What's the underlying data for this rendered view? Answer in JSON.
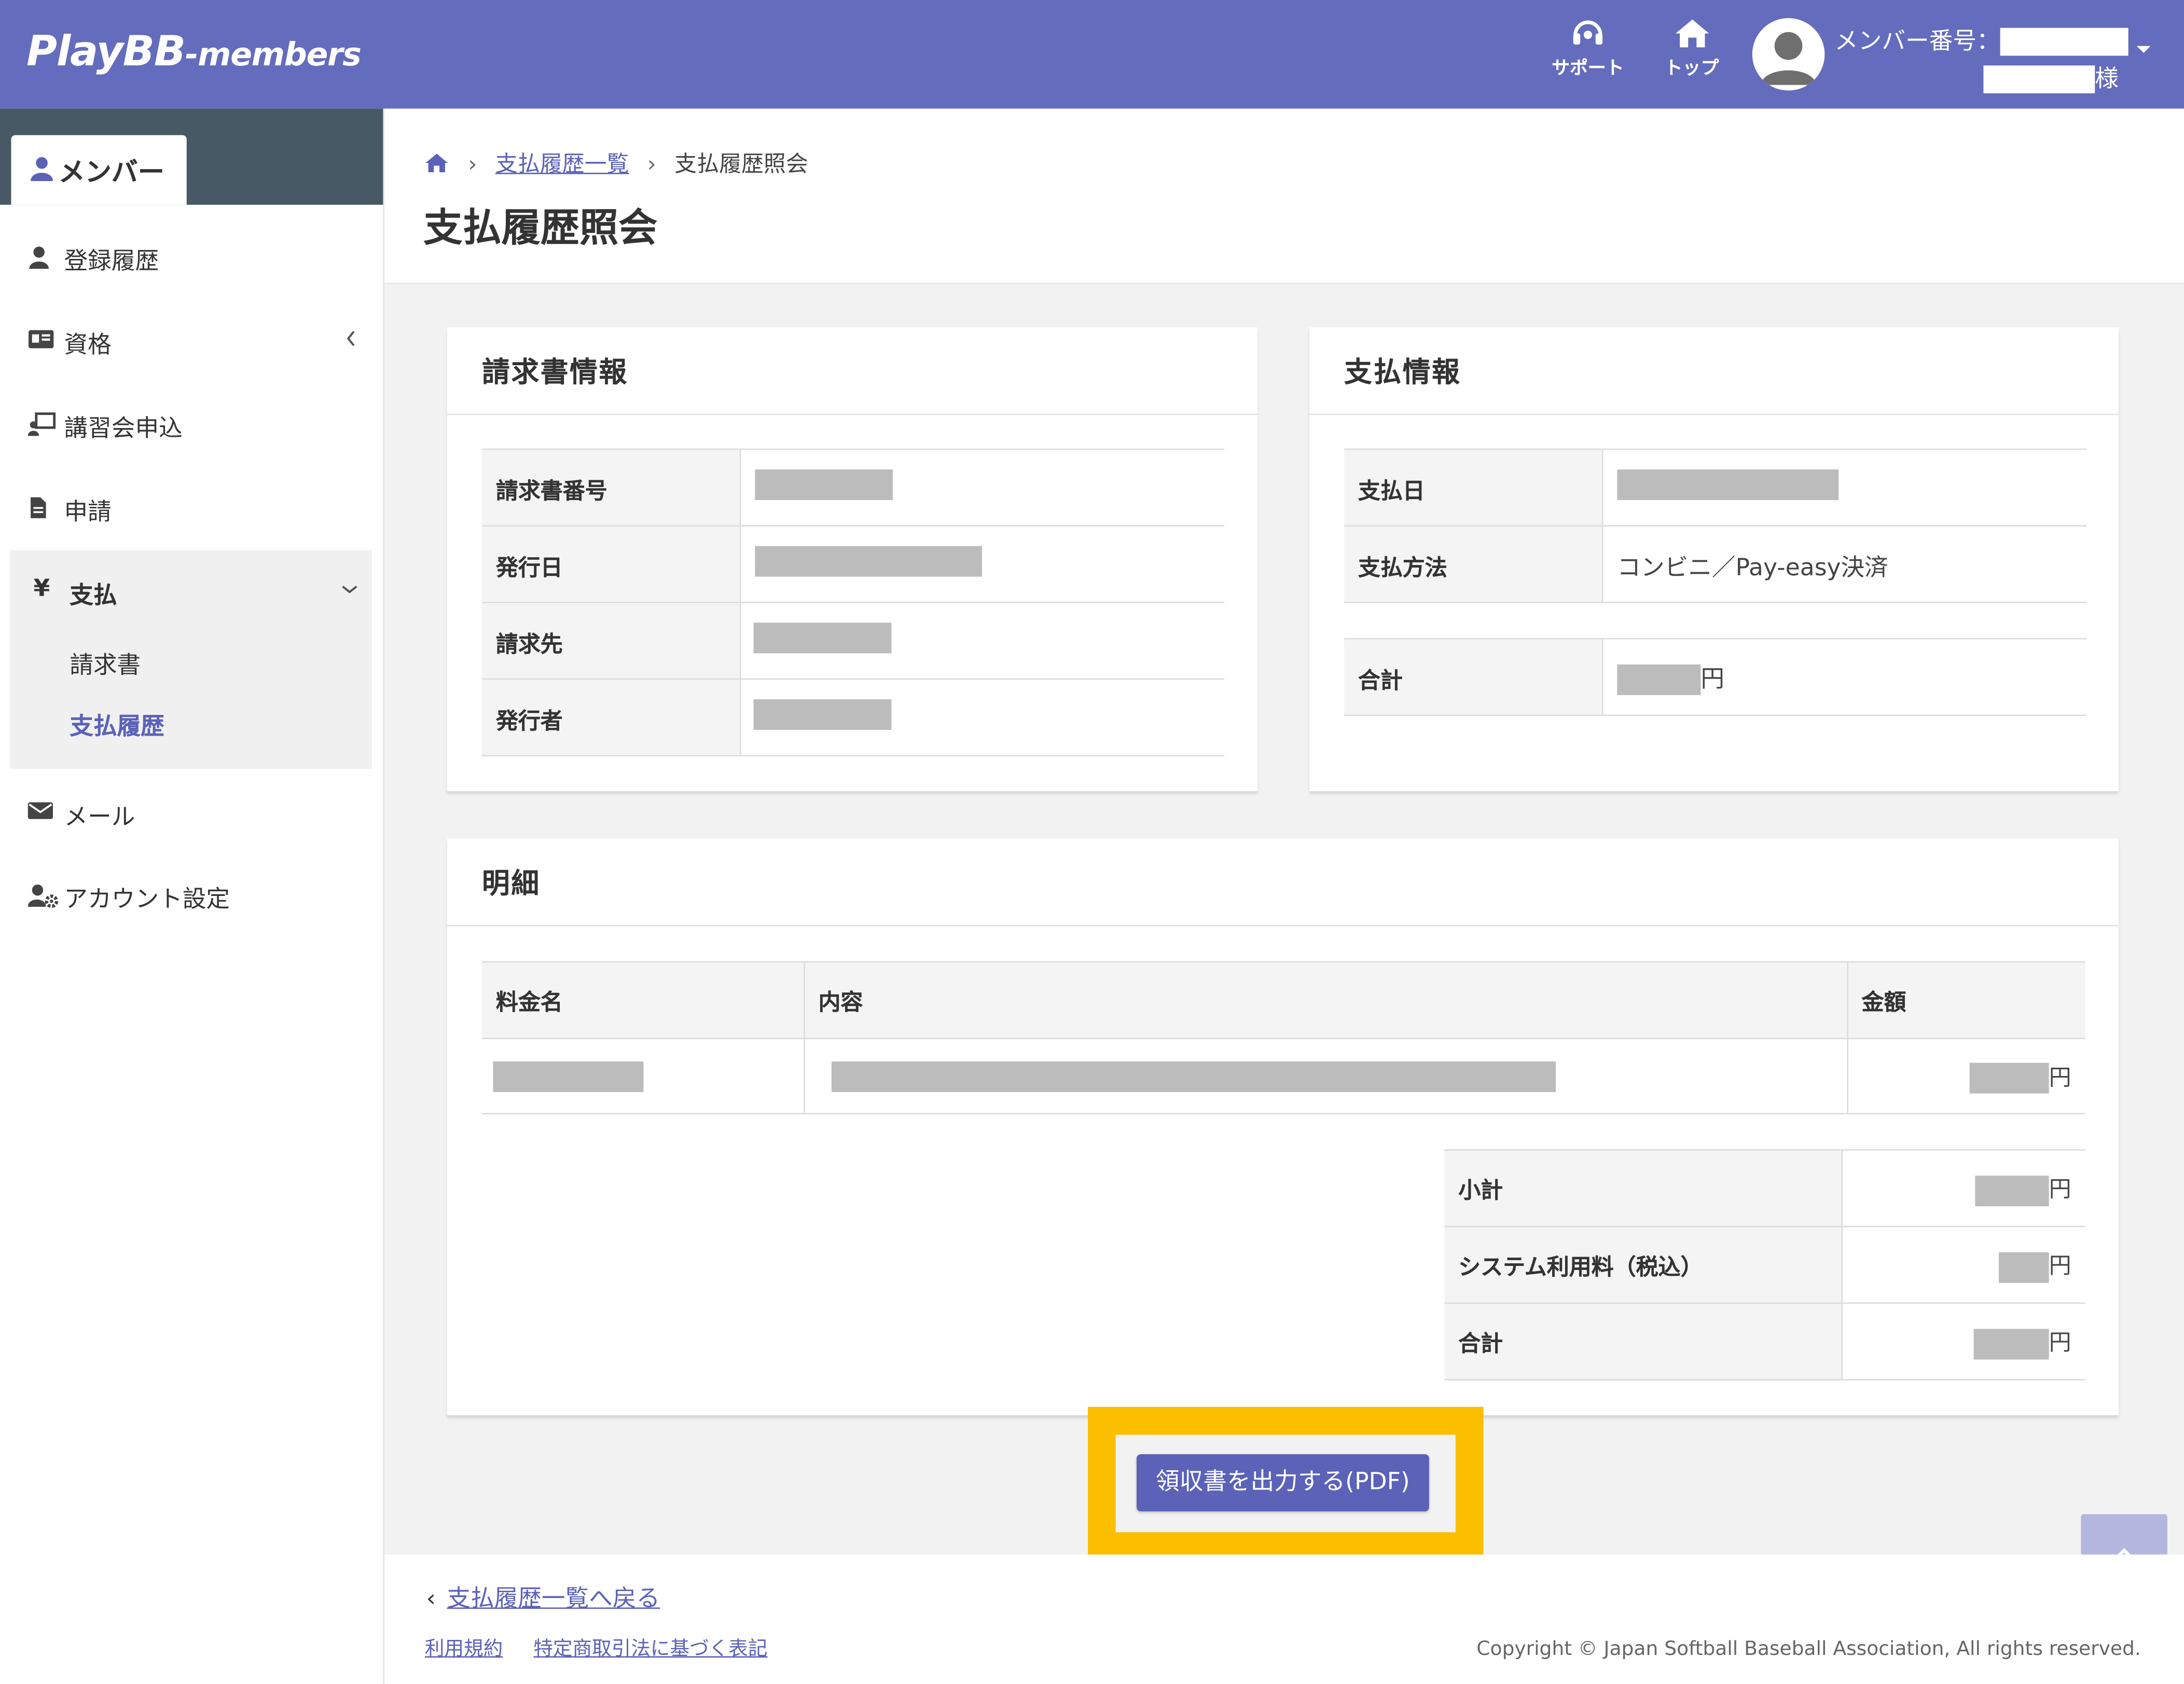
{
  "header": {
    "logo_main": "PlayBB",
    "logo_sub": "-members",
    "nav": [
      {
        "label": "サポート",
        "icon": "headset-icon"
      },
      {
        "label": "トップ",
        "icon": "home-icon"
      }
    ],
    "member_label": "メンバー番号：",
    "honorific": "様"
  },
  "sidebar": {
    "tab_label": "メンバー",
    "items": [
      {
        "label": "登録履歴",
        "icon": "user-icon"
      },
      {
        "label": "資格",
        "icon": "id-card-icon"
      },
      {
        "label": "講習会申込",
        "icon": "presentation-icon"
      },
      {
        "label": "申請",
        "icon": "document-icon"
      },
      {
        "label": "支払",
        "icon": "yen-icon"
      },
      {
        "label": "メール",
        "icon": "envelope-icon"
      },
      {
        "label": "アカウント設定",
        "icon": "user-gear-icon"
      }
    ],
    "pay_sub": [
      {
        "label": "請求書"
      },
      {
        "label": "支払履歴",
        "active": true
      }
    ],
    "yen_glyph": "¥"
  },
  "breadcrumb": {
    "link": "支払履歴一覧",
    "current": "支払履歴照会"
  },
  "page_title": "支払履歴照会",
  "invoice": {
    "title": "請求書情報",
    "rows": [
      {
        "label": "請求書番号"
      },
      {
        "label": "発行日"
      },
      {
        "label": "請求先"
      },
      {
        "label": "発行者"
      }
    ]
  },
  "payment": {
    "title": "支払情報",
    "rows": [
      {
        "label": "支払日",
        "value": ""
      },
      {
        "label": "支払方法",
        "value": "コンビニ／Pay-easy決済"
      }
    ],
    "total_label": "合計",
    "yen": "円"
  },
  "details": {
    "title": "明細",
    "columns": [
      "料金名",
      "内容",
      "金額"
    ],
    "yen": "円",
    "totals": [
      {
        "label": "小計"
      },
      {
        "label": "システム利用料（税込）"
      },
      {
        "label": "合計"
      }
    ]
  },
  "pdf_button": "領収書を出力する(PDF)",
  "footer": {
    "back_link": "支払履歴一覧へ戻る",
    "links": [
      "利用規約",
      "特定商取引法に基づく表記"
    ],
    "copyright": "Copyright © Japan Softball Baseball Association, All rights reserved."
  },
  "colors": {
    "header_bg": "#646cbd",
    "accent": "#5b62b8",
    "highlight": "#fbbf00",
    "sidebar_top": "#475964"
  }
}
